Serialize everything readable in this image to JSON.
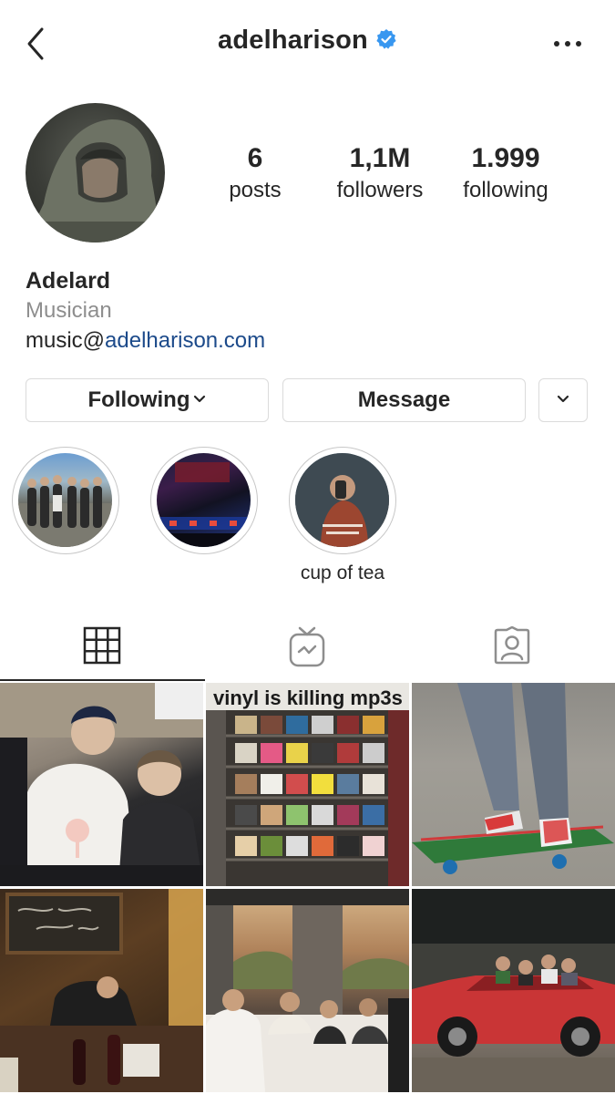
{
  "header": {
    "username": "adelharison",
    "verified": true,
    "back_icon": "chevron-left-icon",
    "more_icon": "more-horizontal-icon"
  },
  "profile": {
    "stats": [
      {
        "count": "6",
        "label": "posts"
      },
      {
        "count": "1,1M",
        "label": "followers"
      },
      {
        "count": "1.999",
        "label": "following"
      }
    ],
    "name": "Adelard",
    "category": "Musician",
    "email_prefix": "music@",
    "email_domain": "adelharison.com"
  },
  "actions": {
    "following_label": "Following",
    "message_label": "Message"
  },
  "highlights": [
    {
      "label": ""
    },
    {
      "label": ""
    },
    {
      "label": "cup of tea"
    }
  ],
  "tabs": [
    "grid-icon",
    "igtv-icon",
    "tagged-icon"
  ],
  "posts": {
    "vinyl_caption": "vinyl is killing mp3s"
  },
  "colors": {
    "verified_badge": "#3897f0",
    "link": "#1c4a8a",
    "secondary_text": "#8e8e8e"
  }
}
